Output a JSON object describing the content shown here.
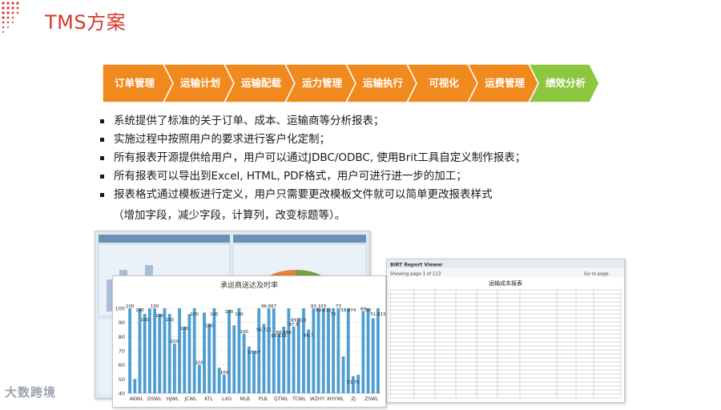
{
  "slide": {
    "title": "TMS方案"
  },
  "process_steps": [
    {
      "label": "订单管理",
      "color": "#f08a1e"
    },
    {
      "label": "运输计划",
      "color": "#f08a1e"
    },
    {
      "label": "运输配载",
      "color": "#f08a1e"
    },
    {
      "label": "运力管理",
      "color": "#f08a1e"
    },
    {
      "label": "运输执行",
      "color": "#f08a1e"
    },
    {
      "label": "可视化",
      "color": "#f08a1e"
    },
    {
      "label": "运费管理",
      "color": "#f08a1e"
    },
    {
      "label": "绩效分析",
      "color": "#8dc63f"
    }
  ],
  "bullets": [
    "系统提供了标准的关于订单、成本、运输商等分析报表；",
    "实施过程中按照用户的要求进行客户化定制；",
    "所有报表开源提供给用户，用户可以通过JDBC/ODBC, 使用Brit工具自定义制作报表；",
    "所有报表可以导出到Excel, HTML, PDF格式，用户可进行进一步的加工；",
    "报表格式通过模板进行定义，用户只需要更改模板文件就可以简单更改报表样式"
  ],
  "bullet_continuation": "（增加字段，减少字段，计算列，改变标题等）。",
  "report_viewer": {
    "header": "BIRT Report Viewer",
    "paging": "Showing page 1 of 113",
    "goto": "Go to page:",
    "title": "运输成本报表"
  },
  "chart_data": {
    "type": "bar",
    "title": "承运商送达及时率",
    "ylim": [
      40,
      100
    ],
    "yticks": [
      40,
      50,
      60,
      70,
      80,
      90,
      100
    ],
    "x_tick_labels": [
      "AKWL",
      "DSWL",
      "HJWL",
      "JCWL",
      "KTL",
      "LXG",
      "MLB",
      "PLB",
      "QTWL",
      "TCWL",
      "WZHY",
      "XHYWL",
      "ZJ",
      "ZSWL"
    ],
    "values": [
      100,
      50,
      100,
      96,
      100,
      100,
      96,
      100,
      96,
      75,
      100,
      87,
      96,
      100,
      60,
      97,
      89,
      100,
      58,
      53,
      99,
      88,
      100,
      82,
      73,
      70,
      100,
      89,
      100,
      100,
      82,
      87,
      100,
      87,
      93,
      100,
      85,
      100,
      100,
      100,
      100,
      100,
      100,
      66,
      100,
      52,
      53,
      98,
      100,
      93,
      100
    ],
    "data_labels": [
      "100",
      "100",
      "100",
      "100",
      "100",
      "100",
      "100",
      "100",
      "100",
      "100",
      "100",
      "100",
      "100",
      "100",
      "100",
      "100",
      "97.67",
      "96.721",
      "96.667",
      "93.333",
      "88.889",
      "87.5",
      "89.333",
      "86.7",
      "93.103",
      "89.615",
      "75",
      "73",
      "58.974",
      "53.70",
      "60",
      "50",
      "51.613"
    ],
    "bar_color": "#4f9ed2"
  },
  "watermark": "大数跨境"
}
